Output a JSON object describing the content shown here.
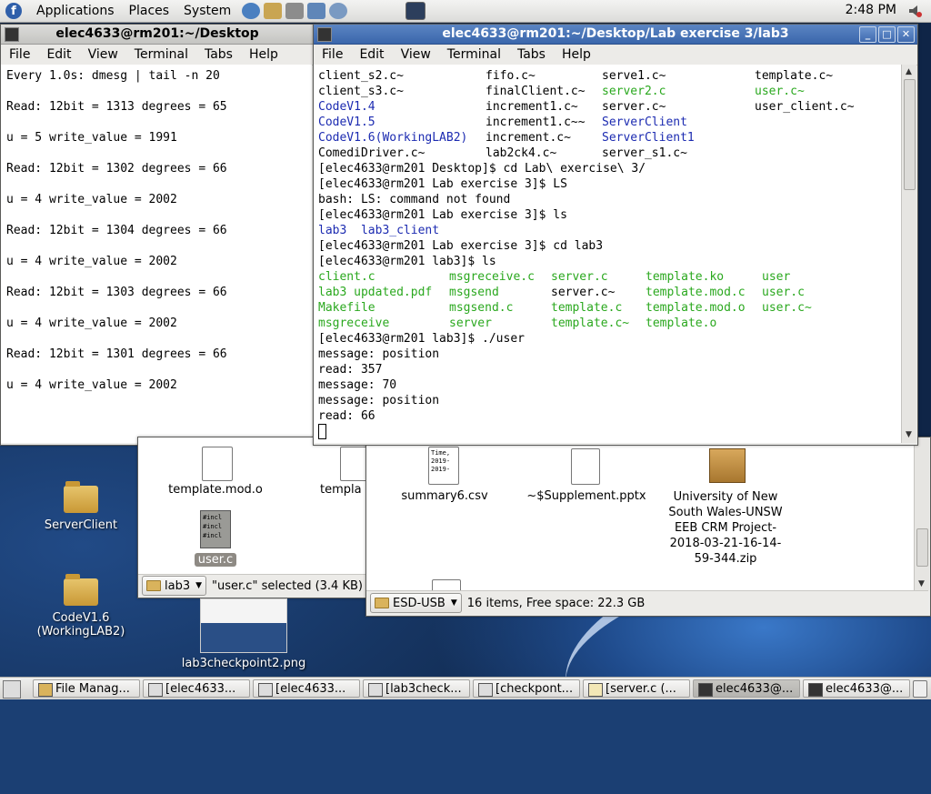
{
  "top_panel": {
    "menus": [
      "Applications",
      "Places",
      "System"
    ],
    "clock": "2:48 PM"
  },
  "left_terminal": {
    "title": "elec4633@rm201:~/Desktop",
    "menus": [
      "File",
      "Edit",
      "View",
      "Terminal",
      "Tabs",
      "Help"
    ],
    "lines": [
      "Every 1.0s: dmesg | tail -n 20",
      "",
      "Read: 12bit = 1313 degrees = 65",
      "",
      "u = 5 write_value = 1991",
      "",
      "Read: 12bit = 1302 degrees = 66",
      "",
      "u = 4 write_value = 2002",
      "",
      "Read: 12bit = 1304 degrees = 66",
      "",
      "u = 4 write_value = 2002",
      "",
      "Read: 12bit = 1303 degrees = 66",
      "",
      "u = 4 write_value = 2002",
      "",
      "Read: 12bit = 1301 degrees = 66",
      "",
      "u = 4 write_value = 2002"
    ]
  },
  "right_terminal": {
    "title": "elec4633@rm201:~/Desktop/Lab exercise 3/lab3",
    "menus": [
      "File",
      "Edit",
      "View",
      "Terminal",
      "Tabs",
      "Help"
    ],
    "listing1": [
      [
        "client_s2.c~",
        "fifo.c~",
        "serve1.c~",
        "template.c~"
      ],
      [
        "client_s3.c~",
        "finalClient.c~",
        "server2.c",
        "user.c~"
      ],
      [
        "CodeV1.4",
        "increment1.c~",
        "server.c~",
        "user_client.c~"
      ],
      [
        "CodeV1.5",
        "increment1.c~~",
        "ServerClient",
        ""
      ],
      [
        "CodeV1.6(WorkingLAB2)",
        "increment.c~",
        "ServerClient1",
        ""
      ],
      [
        "ComediDriver.c~",
        "lab2ck4.c~",
        "server_s1.c~",
        ""
      ]
    ],
    "listing1_colors": [
      [
        "",
        "",
        "",
        ""
      ],
      [
        "",
        "",
        "green",
        "green"
      ],
      [
        "blue",
        "",
        "",
        ""
      ],
      [
        "blue",
        "",
        "blue",
        ""
      ],
      [
        "blue",
        "",
        "blue",
        ""
      ],
      [
        "",
        "",
        "",
        ""
      ]
    ],
    "cmd1": "[elec4633@rm201 Desktop]$ cd Lab\\ exercise\\ 3/",
    "cmd2": "[elec4633@rm201 Lab exercise 3]$ LS",
    "err": "bash: LS: command not found",
    "cmd3": "[elec4633@rm201 Lab exercise 3]$ ls",
    "dir_a": "lab3",
    "dir_b": "lab3_client",
    "cmd4": "[elec4633@rm201 Lab exercise 3]$ cd lab3",
    "cmd5": "[elec4633@rm201 lab3]$ ls",
    "listing2": [
      [
        "client.c",
        "msgreceive.c",
        "server.c",
        "template.ko",
        "user"
      ],
      [
        "lab3 updated.pdf",
        "msgsend",
        "server.c~",
        "template.mod.c",
        "user.c"
      ],
      [
        "Makefile",
        "msgsend.c",
        "template.c",
        "template.mod.o",
        "user.c~"
      ],
      [
        "msgreceive",
        "server",
        "template.c~",
        "template.o",
        ""
      ]
    ],
    "listing2_colors": [
      [
        "green",
        "green",
        "green",
        "green",
        "green"
      ],
      [
        "green",
        "green",
        "",
        "green",
        "green"
      ],
      [
        "green",
        "green",
        "green",
        "green",
        "green"
      ],
      [
        "green",
        "green",
        "green",
        "green",
        ""
      ]
    ],
    "cmd6": "[elec4633@rm201 lab3]$ ./user",
    "out": [
      "message: position",
      "read: 357",
      "message: 70",
      "message: position",
      "read: 66"
    ]
  },
  "lab3_browser": {
    "items": [
      "template.mod.o",
      "templa",
      "user.c"
    ],
    "doc_lines": [
      "#incl",
      "#incl",
      "#incl"
    ],
    "location": "lab3",
    "status": "\"user.c\" selected (3.4 KB)"
  },
  "usb_browser": {
    "items": [
      "summary6.csv",
      "~$Supplement.pptx",
      "University of New South Wales-UNSW EEB CRM Project-2018-03-21-16-14-59-344.zip"
    ],
    "csv_preview": [
      "Time,",
      "2019-",
      "2019-"
    ],
    "location": "ESD-USB",
    "status": "16 items, Free space: 22.3 GB"
  },
  "desktop_icons": {
    "server_client": "ServerClient",
    "codev16": "CodeV1.6 (WorkingLAB2)",
    "screenshot": "lab3checkpoint2.png"
  },
  "taskbar": [
    "File Manag...",
    "[elec4633...",
    "[elec4633...",
    "[lab3check...",
    "[checkpont...",
    "[server.c (...",
    "elec4633@...",
    "elec4633@..."
  ]
}
